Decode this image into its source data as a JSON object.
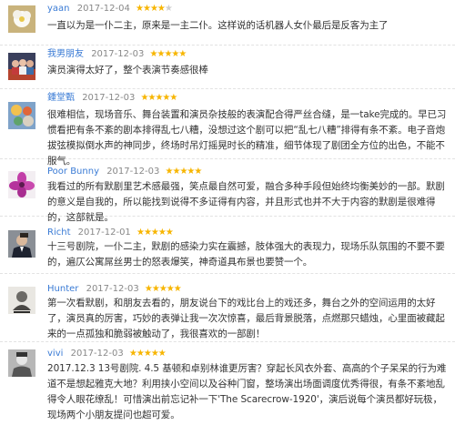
{
  "reviews": [
    {
      "user": "yaan",
      "date": "2017-12-04",
      "rating": 4,
      "avatar_icon": "white-flower-icon",
      "text": "一直以为是一仆二主，原来是一主二仆。这样说的话机器人女仆最后是反客为主了"
    },
    {
      "user": "我男朋友",
      "date": "2017-12-03",
      "rating": 5,
      "avatar_icon": "group-photo-icon",
      "text": "演员演得太好了，整个表演节奏感很棒"
    },
    {
      "user": "鍾堂甄",
      "date": "2017-12-03",
      "rating": 5,
      "avatar_icon": "colorful-pattern-icon",
      "text": "很难相信，现场音乐、舞台装置和演员杂技般的表演配合得严丝合缝，是一take完成的。早已习惯看把有条不紊的剧本排得乱七八糟，没想过这个剧可以把“乱七八糟”排得有条不紊。电子音炮拔弦模拟倒水声的神同步，终场时吊灯摇晃时长的精准，细节体现了剧团全方位的出色，不能不服气。"
    },
    {
      "user": "Poor Bunny",
      "date": "2017-12-03",
      "rating": 5,
      "avatar_icon": "purple-flower-icon",
      "text": "我看过的所有默剧里艺术感最强，笑点最自然可爱，融合多种手段但始终均衡美妙的一部。默剧的意义是自我的，所以能找到说得不多证得有内容，并且形式也并不大于内容的默剧是很难得的，这部就是。"
    },
    {
      "user": "Richt",
      "date": "2017-12-01",
      "rating": 5,
      "avatar_icon": "portrait-photo-icon",
      "text": "十三号剧院，一仆二主，默剧的感染力实在震撼，肢体强大的表现力，现场乐队氛围的不要不要的，遍仄公寓屌丝男士的怒表爆笑，神奇道具布景也要赞一个。"
    },
    {
      "user": "Hunter",
      "date": "2017-12-03",
      "rating": 5,
      "avatar_icon": "sketch-avatar-icon",
      "text": "第一次看默剧，和朋友去看的，朋友说台下的戏比台上的戏还多，舞台之外的空间运用的太好了，演员真的厉害，巧妙的表弹让我一次次惊喜，最后背景脱落，点燃那只蜡烛，心里面被藏起来的一点孤独和脆弱被触动了，我很喜欢的一部剧！"
    },
    {
      "user": "vivi",
      "date": "2017-12-03",
      "rating": 5,
      "avatar_icon": "bw-photo-icon",
      "text": "2017.12.3 13号剧院. 4.5 基顿和卓别林谁更厉害？穿起长风衣外套、高高的个子呆呆的行为难道不是想起雅克大地？利用挟小空间以及谷种门窗，整场演出场面调度优秀得很，有条不紊地乱得令人眼花缭乱！可惜演出前忘记补一下'The Scarecrow-1920'，演后说每个演员都好玩极，现场两个小朋友提问也超可爱。"
    }
  ]
}
